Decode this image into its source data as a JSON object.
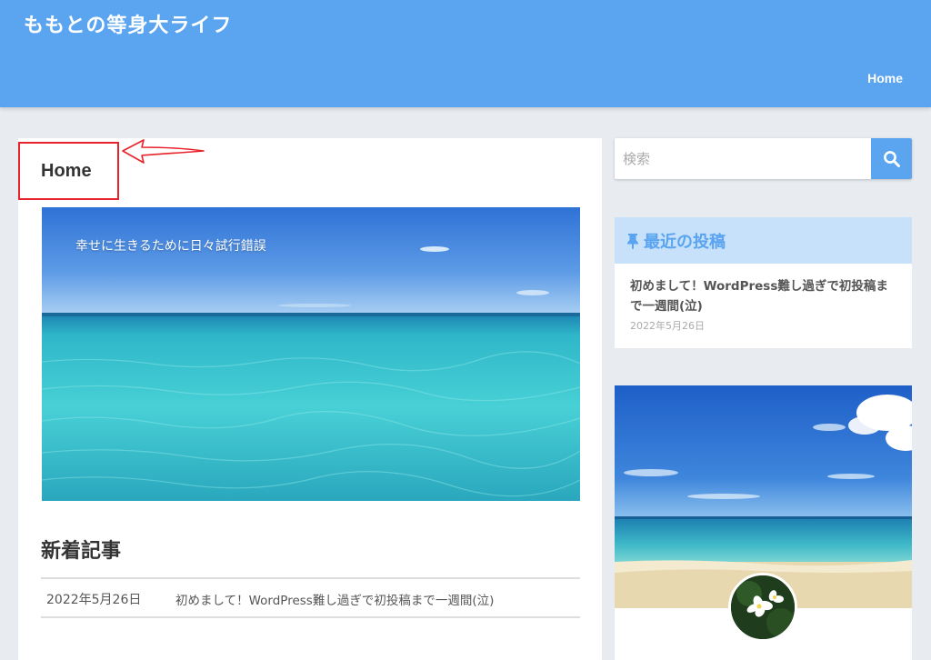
{
  "header": {
    "site_title": "ももとの等身大ライフ",
    "nav": {
      "home_label": "Home"
    }
  },
  "main": {
    "page_title": "Home",
    "hero_caption": "幸せに生きるために日々試行錯誤",
    "section_title": "新着記事",
    "news": [
      {
        "date": "2022年5月26日",
        "title": "初めまして！WordPress難し過ぎで初投稿まで一週間(泣)"
      }
    ]
  },
  "sidebar": {
    "search": {
      "placeholder": "検索"
    },
    "recent": {
      "title": "最近の投稿",
      "items": [
        {
          "title": "初めまして！WordPress難し過ぎで初投稿まで一週間(泣)",
          "date": "2022年5月26日"
        }
      ]
    }
  },
  "colors": {
    "header_bg": "#5aa4f0",
    "accent": "#5aa4f0",
    "widget_header_bg": "#c7e1fb",
    "annotation": "#e8222a"
  },
  "icons": {
    "search": "search-icon",
    "pin": "pin-icon"
  }
}
